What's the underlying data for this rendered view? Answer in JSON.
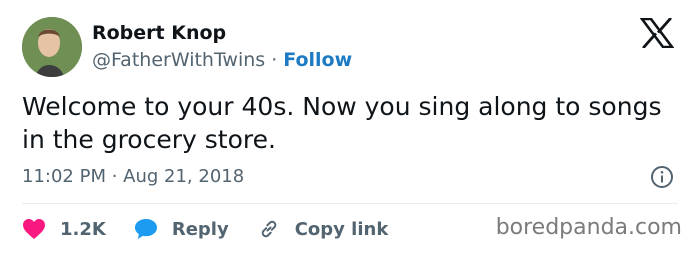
{
  "author": {
    "name": "Robert Knop",
    "handle": "@FatherWithTwins",
    "separator": "·",
    "follow_label": "Follow"
  },
  "tweet": {
    "text": "Welcome to your 40s. Now you sing along to songs in the grocery store.",
    "timestamp": "11:02 PM · Aug 21, 2018"
  },
  "actions": {
    "likes": "1.2K",
    "reply_label": "Reply",
    "copy_link_label": "Copy link"
  },
  "icons": {
    "platform": "x-logo-icon",
    "info": "info-icon",
    "like": "heart-icon",
    "reply": "speech-bubble-icon",
    "copy": "link-icon"
  },
  "colors": {
    "follow": "#1d7bc4",
    "heart": "#f91880",
    "reply_bubble": "#1d9bf0",
    "muted": "#536471"
  },
  "watermark": "boredpanda.com"
}
